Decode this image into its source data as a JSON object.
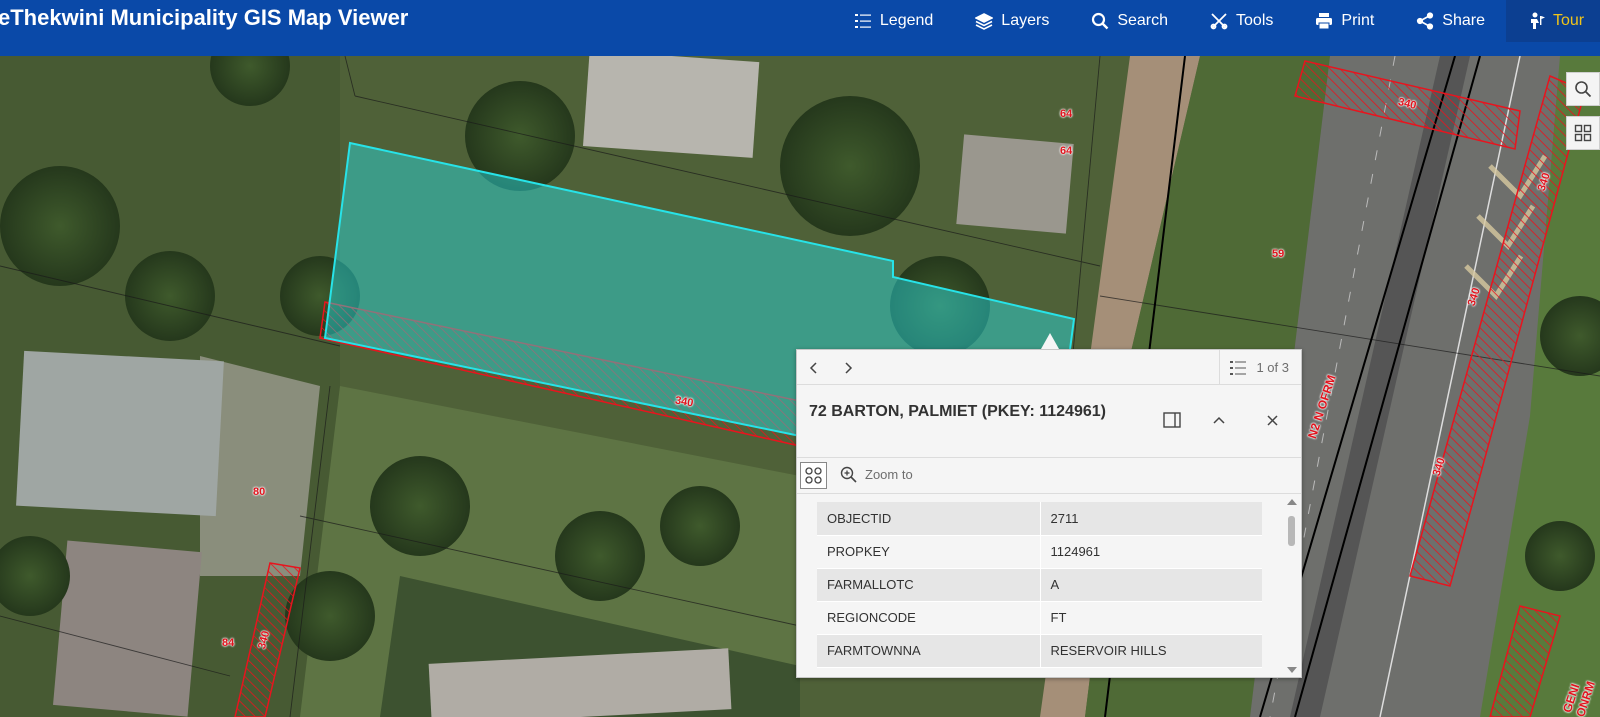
{
  "header": {
    "title": "eThekwini Municipality GIS Map Viewer",
    "nav": [
      {
        "label": "Legend",
        "icon": "list-icon"
      },
      {
        "label": "Layers",
        "icon": "layers-icon"
      },
      {
        "label": "Search",
        "icon": "search-icon"
      },
      {
        "label": "Tools",
        "icon": "tools-icon"
      },
      {
        "label": "Print",
        "icon": "print-icon"
      },
      {
        "label": "Share",
        "icon": "share-icon"
      },
      {
        "label": "Tour",
        "icon": "tour-icon"
      }
    ],
    "colors": {
      "bar": "#0a49a8",
      "tour_text": "#f0c419"
    }
  },
  "map": {
    "lot_labels": [
      "64",
      "64",
      "59",
      "80",
      "84"
    ],
    "servitude_labels": [
      "340",
      "340",
      "340",
      "340",
      "340",
      "340"
    ],
    "road_labels": [
      "N2 N OFRM",
      "GENI ONRM"
    ],
    "colors": {
      "selection": "#27e3e8",
      "servitude": "#e8141e"
    }
  },
  "popup": {
    "feature_count": "1 of 3",
    "title": "72 BARTON, PALMIET (PKEY: 1124961)",
    "zoom_label": "Zoom to",
    "attributes": [
      {
        "key": "OBJECTID",
        "value": "2711"
      },
      {
        "key": "PROPKEY",
        "value": "1124961"
      },
      {
        "key": "FARMALLOTC",
        "value": "A"
      },
      {
        "key": "REGIONCODE",
        "value": "FT"
      },
      {
        "key": "FARMTOWNNA",
        "value": "RESERVOIR HILLS"
      }
    ]
  }
}
